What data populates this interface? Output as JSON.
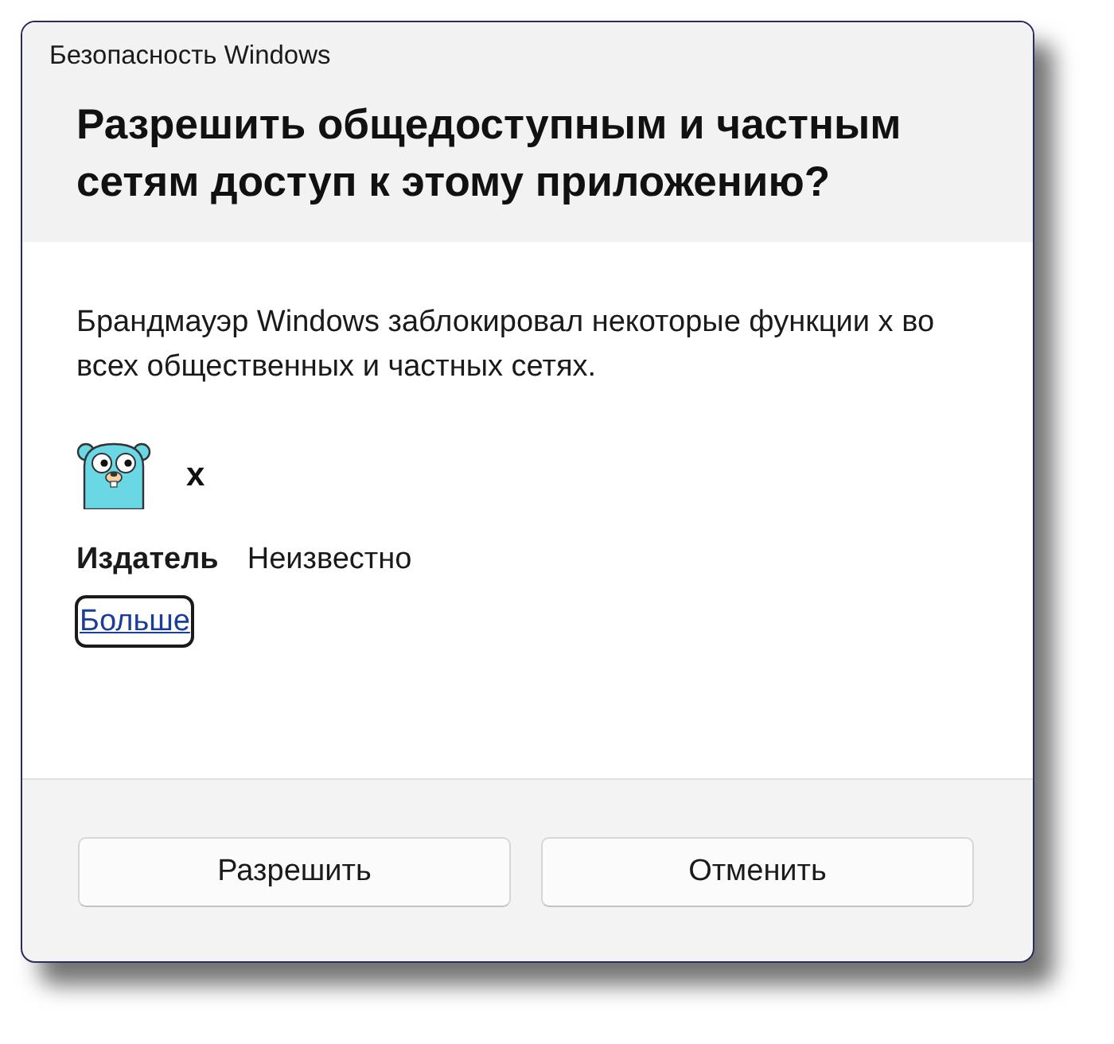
{
  "window": {
    "title": "Безопасность Windows"
  },
  "header": {
    "heading": "Разрешить общедоступным и частным сетям доступ к этому приложению?"
  },
  "body": {
    "message": "Брандмауэр Windows заблокировал некоторые функции x во всех общественных и частных сетях.",
    "app": {
      "name": "x"
    },
    "publisher": {
      "label": "Издатель",
      "value": "Неизвестно"
    },
    "more_link": {
      "label": "Больше",
      "focused": true
    }
  },
  "buttons": [
    {
      "label": "Разрешить"
    },
    {
      "label": "Отменить"
    }
  ]
}
